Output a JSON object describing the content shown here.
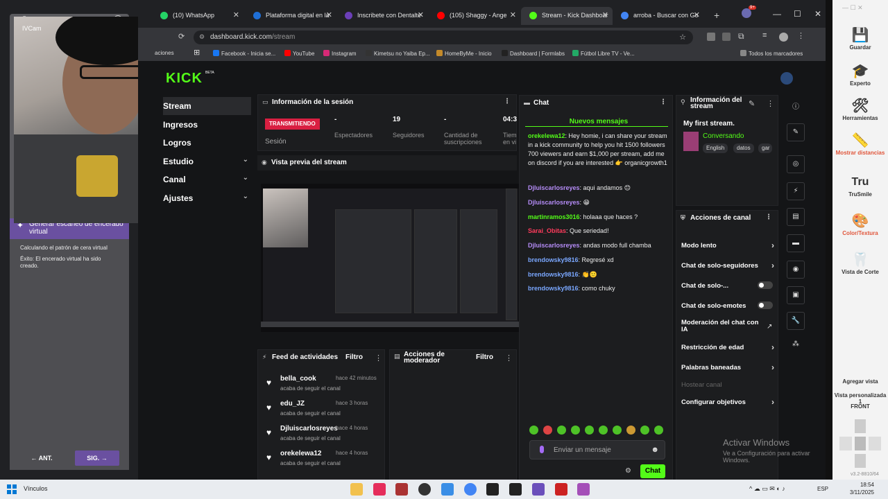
{
  "browser": {
    "tabs": [
      {
        "title": "(10) WhatsApp",
        "color": "#25d366"
      },
      {
        "title": "Plataforma digital en la",
        "color": "#1f6fd6"
      },
      {
        "title": "Inscribete con Dentalte",
        "color": "#6b3fb8"
      },
      {
        "title": "(105) Shaggy - Ange",
        "color": "#ff0000"
      },
      {
        "title": "Stream - Kick Dashboar",
        "color": "#53fc18"
      },
      {
        "title": "arroba - Buscar con Go",
        "color": "#4285f4"
      }
    ],
    "url_host": "dashboard.kick.com",
    "url_path": "/stream",
    "notif_badge": "9+",
    "bookmarks": [
      {
        "label": "aciones",
        "color": "#555"
      },
      {
        "label": "Facebook - Inicia se...",
        "color": "#1877f2"
      },
      {
        "label": "YouTube",
        "color": "#ff0000"
      },
      {
        "label": "Instagram",
        "color": "#d62976"
      },
      {
        "label": "Kimetsu no Yaiba Ep...",
        "color": "#333"
      },
      {
        "label": "HomeByMe - Inicio",
        "color": "#c48a2a"
      },
      {
        "label": "Dashboard | Formlabs",
        "color": "#222"
      },
      {
        "label": "Fútbol Libre TV - Ve...",
        "color": "#2a6"
      }
    ],
    "all_bookmarks": "Todos los marcadores"
  },
  "left_app": {
    "group_label": "Grupos",
    "cam_label": "IVCam",
    "scan_title": "Generar escaneo de encerado virtual",
    "step1": "Calculando el patrón de cera virtual",
    "step2": "Éxito: El encerado virtual ha sido creado.",
    "prev": "ANT.",
    "next": "SIG."
  },
  "kick": {
    "beta": "BETA",
    "logo": "KICK",
    "nav": [
      {
        "label": "Stream",
        "chev": false
      },
      {
        "label": "Ingresos",
        "chev": false
      },
      {
        "label": "Logros",
        "chev": false
      },
      {
        "label": "Estudio",
        "chev": true
      },
      {
        "label": "Canal",
        "chev": true
      },
      {
        "label": "Ajustes",
        "chev": true
      }
    ],
    "session": {
      "title": "Información de la sesión",
      "live": "TRANSMITIENDO",
      "session_label": "Sesión",
      "stats": [
        {
          "value": "-",
          "label": "Espectadores"
        },
        {
          "value": "19",
          "label": "Seguidores"
        },
        {
          "value": "-",
          "label": "Cantidad de suscripciones"
        },
        {
          "value": "04:3",
          "label": "Tiem en vi"
        }
      ]
    },
    "preview_title": "Vista previa del stream",
    "feed": {
      "title": "Feed de actividades",
      "filter": "Filtro",
      "items": [
        {
          "user": "bella_cook",
          "time": "hace 42 minutos",
          "desc": "acaba de seguir el canal"
        },
        {
          "user": "edu_JZ",
          "time": "hace 3 horas",
          "desc": "acaba de seguir el canal"
        },
        {
          "user": "Djluiscarlosreyes",
          "time": "hace 4 horas",
          "desc": "acaba de seguir el canal"
        },
        {
          "user": "orekelewa12",
          "time": "hace 4 horas",
          "desc": "acaba de seguir el canal"
        }
      ]
    },
    "mod": {
      "title": "Acciones de moderador",
      "filter": "Filtro"
    },
    "chat": {
      "title": "Chat",
      "new_messages": "Nuevos mensajes",
      "messages": [
        {
          "user": "orekelewa12",
          "color": "#53fc18",
          "text": ": Hey homie, i can share your stream in a kick community to help you hit 1500 followers 700 viewers and earn $1,000 per stream, add me on discord if you are interested 👉 organicgrowth1"
        },
        {
          "user": "Djluiscarlosreyes",
          "color": "#b58cf7",
          "text": ": aqui andamos 😊"
        },
        {
          "user": "Djluiscarlosreyes",
          "color": "#b58cf7",
          "text": ": 😁"
        },
        {
          "user": "martinramos3016",
          "color": "#53fc18",
          "text": ": holaaa que haces ?"
        },
        {
          "user": "Sarai_Obitas",
          "color": "#ff3b5c",
          "text": ": Que seriedad!"
        },
        {
          "user": "Djluiscarlosreyes",
          "color": "#b58cf7",
          "text": ": andas modo full chamba"
        },
        {
          "user": "brendowsky9816",
          "color": "#7aa7ff",
          "text": ": Regresé xd"
        },
        {
          "user": "brendowsky9816",
          "color": "#7aa7ff",
          "text": ": 👏🙂"
        },
        {
          "user": "brendowsky9816",
          "color": "#7aa7ff",
          "text": ": como chuky"
        }
      ],
      "placeholder": "Enviar un mensaje",
      "send": "Chat"
    },
    "stream_info": {
      "title": "Información del stream",
      "stream_title": "My first stream.",
      "category": "Conversando",
      "tags": [
        "English",
        "datos",
        "gar"
      ]
    },
    "channel_actions": {
      "title": "Acciones de canal",
      "items": [
        {
          "label": "Modo lento",
          "type": "chev"
        },
        {
          "label": "Chat de solo-seguidores",
          "type": "chev"
        },
        {
          "label": "Chat de solo-...",
          "type": "toggle"
        },
        {
          "label": "Chat de solo-emotes",
          "type": "toggle"
        },
        {
          "label": "Moderación del chat con IA",
          "type": "ext"
        },
        {
          "label": "Restricción de edad",
          "type": "chev"
        },
        {
          "label": "Palabras baneadas",
          "type": "chev"
        },
        {
          "label": "Hostear canal",
          "type": "disabled"
        },
        {
          "label": "Configurar objetivos",
          "type": "chev"
        }
      ]
    },
    "activate_windows": "Activar Windows",
    "activate_sub": "Ve a Configuración para activar Windows."
  },
  "tools": {
    "items": [
      {
        "label": "Guardar",
        "icon": "save-icon",
        "glyph": "💾",
        "color": "#333"
      },
      {
        "label": "Experto",
        "icon": "graduation-cap-icon",
        "glyph": "🎓",
        "color": "#333"
      },
      {
        "label": "Herramientas",
        "icon": "tools-icon",
        "glyph": "🛠",
        "color": "#333"
      },
      {
        "label": "Mostrar distancias",
        "icon": "distance-icon",
        "glyph": "📏",
        "color": "#e0553a"
      },
      {
        "label": "TruSmile",
        "icon": "trusmile-icon",
        "glyph": "Tru",
        "color": "#333"
      },
      {
        "label": "Color/Textura",
        "icon": "color-texture-icon",
        "glyph": "🎨",
        "color": "#e0553a"
      },
      {
        "label": "Vista de Corte",
        "icon": "cut-view-icon",
        "glyph": "🦷",
        "color": "#333"
      }
    ],
    "add_view": "Agregar vista",
    "custom_view": "Vista personalizada 1",
    "front": "FRONT",
    "version": "v3.2-8810/64"
  },
  "taskbar": {
    "search": "Vínculos",
    "lang": "ESP",
    "time": "18:54",
    "date": "3/11/2025"
  }
}
